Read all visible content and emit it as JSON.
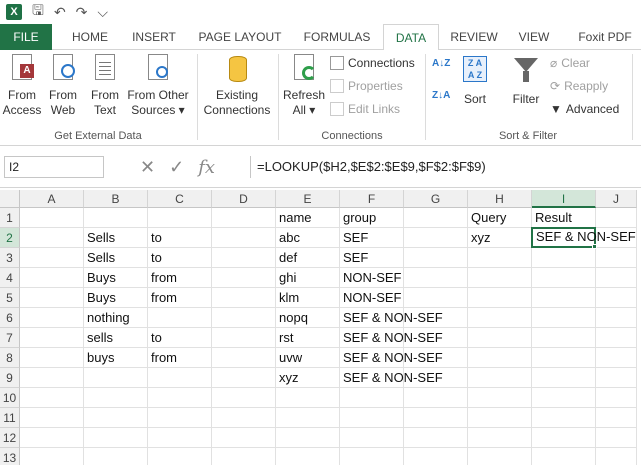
{
  "tabs": [
    "FILE",
    "HOME",
    "INSERT",
    "PAGE LAYOUT",
    "FORMULAS",
    "DATA",
    "REVIEW",
    "VIEW",
    "Foxit PDF"
  ],
  "ribbon": {
    "get_external": {
      "buttons": [
        [
          "From",
          "Access"
        ],
        [
          "From",
          "Web"
        ],
        [
          "From",
          "Text"
        ],
        [
          "From Other",
          "Sources ▾"
        ]
      ],
      "label": "Get External Data"
    },
    "existing": [
      "Existing",
      "Connections"
    ],
    "refresh": [
      "Refresh",
      "All ▾"
    ],
    "connections": {
      "items": [
        "Connections",
        "Properties",
        "Edit Links"
      ],
      "label": "Connections"
    },
    "sort": {
      "sort_label": "Sort",
      "filter_label": "Filter",
      "clear": "Clear",
      "reapply": "Reapply",
      "advanced": "Advanced",
      "label": "Sort & Filter"
    }
  },
  "formula_bar": {
    "name_box": "I2",
    "formula": "=LOOKUP($H2,$E$2:$E$9,$F$2:$F$9)"
  },
  "columns": [
    "A",
    "B",
    "C",
    "D",
    "E",
    "F",
    "G",
    "H",
    "I",
    "J"
  ],
  "rows": [
    "1",
    "2",
    "3",
    "4",
    "5",
    "6",
    "7",
    "8",
    "9",
    "10",
    "11",
    "12",
    "13"
  ],
  "cells": {
    "E1": "name",
    "F1": "group",
    "H1": "Query",
    "I1": "Result",
    "B2": "Sells",
    "C2": "to",
    "E2": "abc",
    "F2": "SEF",
    "H2": "xyz",
    "I2": "SEF & NON-SEF",
    "B3": "Sells",
    "C3": "to",
    "E3": "def",
    "F3": "SEF",
    "B4": "Buys",
    "C4": "from",
    "E4": "ghi",
    "F4": "NON-SEF",
    "B5": "Buys",
    "C5": "from",
    "E5": "klm",
    "F5": "NON-SEF",
    "B6": "nothing",
    "E6": "nopq",
    "F6": "SEF & NON-SEF",
    "B7": "sells",
    "C7": "to",
    "E7": "rst",
    "F7": "SEF & NON-SEF",
    "B8": "buys",
    "C8": "from",
    "E8": "uvw",
    "F8": "SEF & NON-SEF",
    "E9": "xyz",
    "F9": "SEF & NON-SEF"
  },
  "colors": {
    "accent": "#217346"
  }
}
